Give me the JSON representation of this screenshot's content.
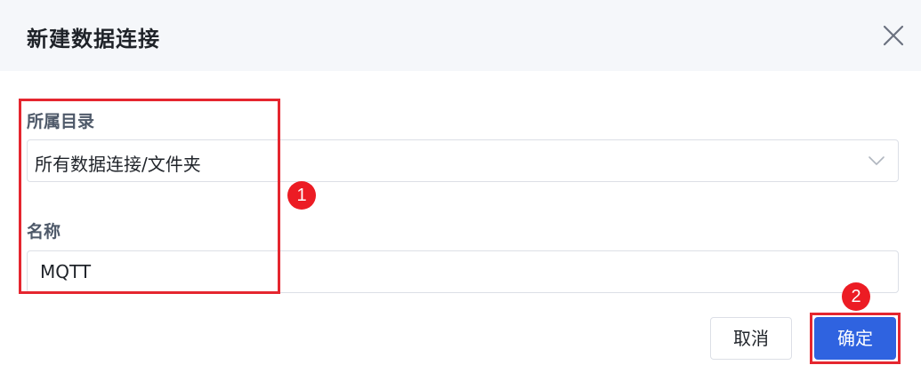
{
  "dialog": {
    "title": "新建数据连接",
    "close_icon": "close-icon"
  },
  "form": {
    "directory": {
      "label": "所属目录",
      "value": "所有数据连接/文件夹",
      "arrow_icon": "chevron-down-icon"
    },
    "name": {
      "label": "名称",
      "value": "MQTT"
    }
  },
  "footer": {
    "cancel_label": "取消",
    "confirm_label": "确定"
  },
  "annotations": {
    "badge_1": "1",
    "badge_2": "2",
    "highlight_color": "#e5262f"
  },
  "colors": {
    "primary": "#2f63e0",
    "header_bg": "#f5f7fa",
    "border": "#dcdfe6"
  }
}
